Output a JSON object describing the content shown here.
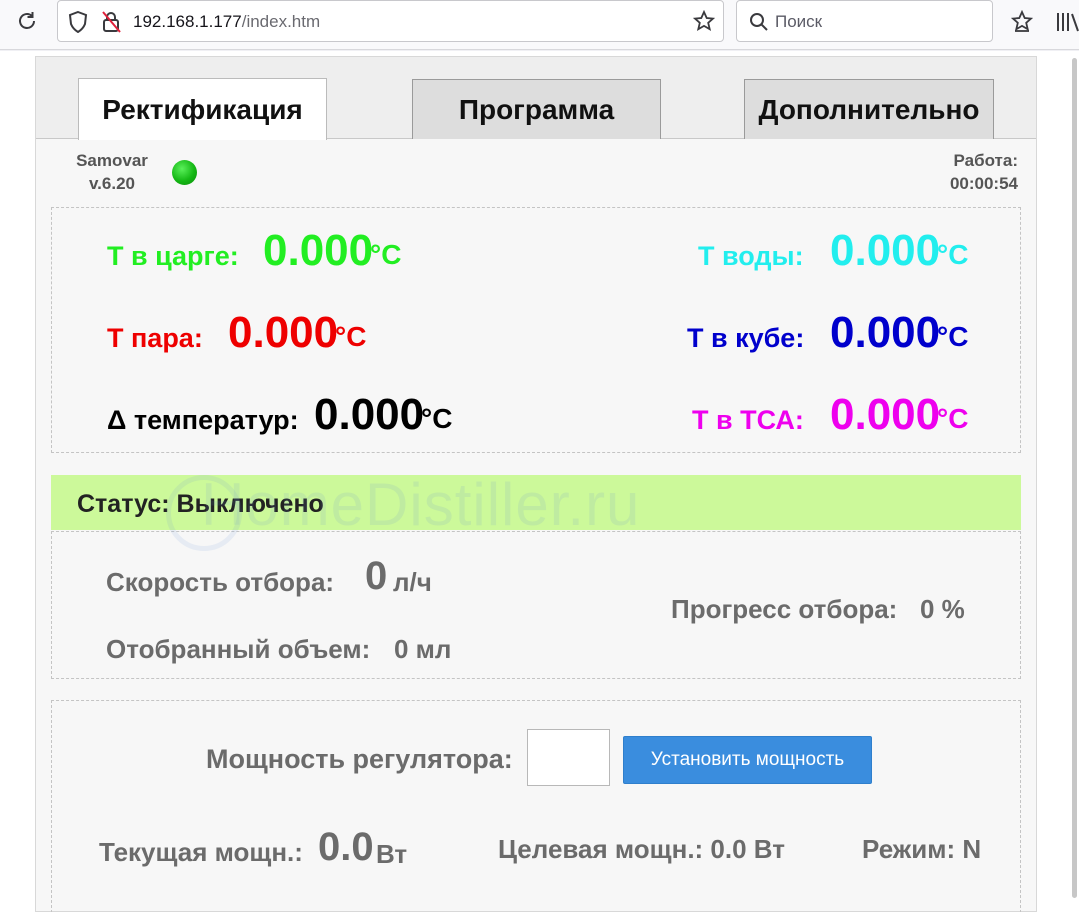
{
  "browser": {
    "url_host": "192.168.1.177",
    "url_path": "/index.htm",
    "search_placeholder": "Поиск"
  },
  "tabs": [
    {
      "label": "Ректификация",
      "active": true
    },
    {
      "label": "Программа",
      "active": false
    },
    {
      "label": "Дополнительно",
      "active": false
    }
  ],
  "header": {
    "app_name": "Samovar",
    "version": "v.6.20",
    "status_led_color": "#19c419",
    "work_label": "Работа:",
    "work_time": "00:00:54"
  },
  "temperatures": {
    "column": {
      "label": "Т в царге:",
      "value": "0.000",
      "unit": "°C",
      "color": "#22ee22"
    },
    "vapor": {
      "label": "Т пара:",
      "value": "0.000",
      "unit": "°C",
      "color": "#ee0000"
    },
    "delta": {
      "label": "Δ температур:",
      "value": "0.000",
      "unit": "°C",
      "color": "#000000"
    },
    "water": {
      "label": "Т воды:",
      "value": "0.000",
      "unit": "°C",
      "color": "#22eeee"
    },
    "cube": {
      "label": "Т в кубе:",
      "value": "0.000",
      "unit": "°C",
      "color": "#0000cc"
    },
    "tsa": {
      "label": "Т в ТСА:",
      "value": "0.000",
      "unit": "°C",
      "color": "#ee00ee"
    }
  },
  "status": {
    "text": "Статус: Выключено",
    "bg_color": "#ccf99a"
  },
  "stats": {
    "speed_label": "Скорость отбора:",
    "speed_value": "0",
    "speed_unit": "л/ч",
    "volume_label": "Отобранный объем:",
    "volume_value": "0 мл",
    "progress_label": "Прогресс отбора:",
    "progress_value": "0 %"
  },
  "power": {
    "regulator_label": "Мощность регулятора:",
    "input_value": "",
    "set_button": "Установить мощность",
    "current_label": "Текущая мощн.:",
    "current_value": "0.0",
    "current_unit": "Вт",
    "target_label": "Целевая мощн.: 0.0 Вт",
    "mode_label": "Режим: N"
  },
  "watermark": "HomeDistiller.ru"
}
